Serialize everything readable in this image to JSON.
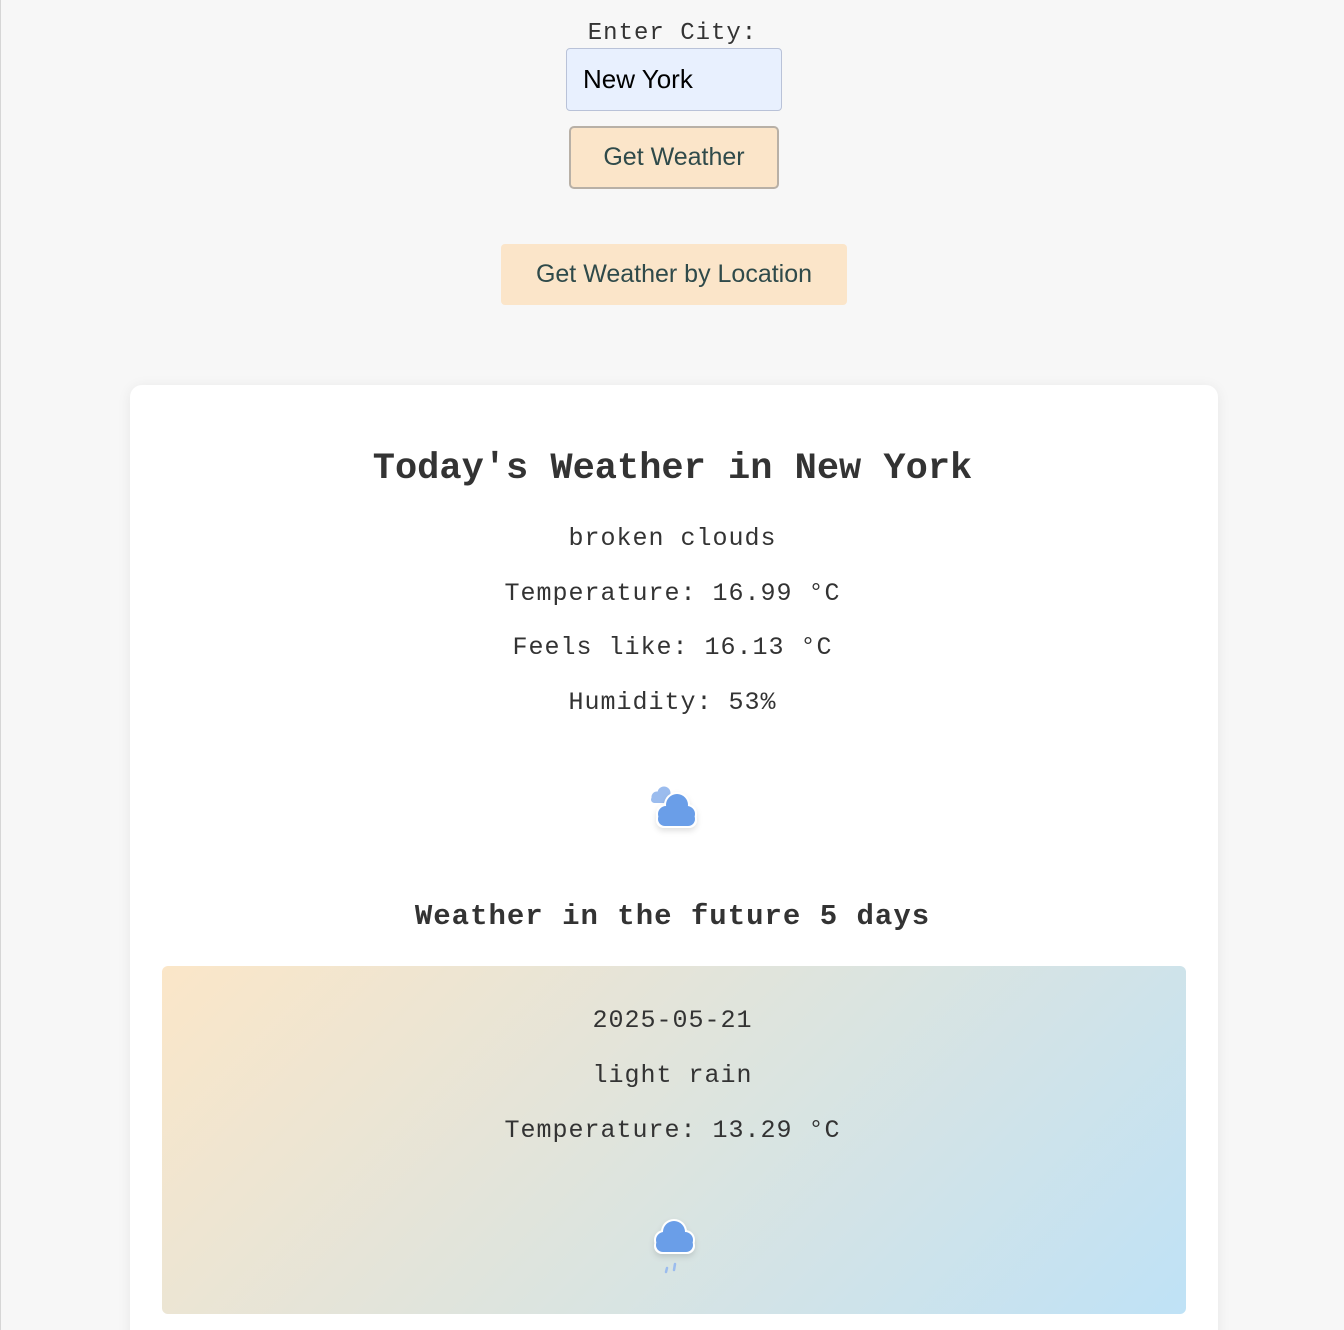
{
  "search": {
    "label": "Enter City:",
    "input_value": "New York",
    "get_weather_label": "Get Weather",
    "location_label": "Get Weather by Location"
  },
  "today": {
    "title": "Today's Weather in New York",
    "description": "broken clouds",
    "temperature": "Temperature: 16.99 °C",
    "feels_like": "Feels like: 16.13 °C",
    "humidity": "Humidity: 53%",
    "icon": "broken-clouds-icon"
  },
  "forecast": {
    "title": "Weather in the future 5 days",
    "days": [
      {
        "date": "2025-05-21",
        "description": "light rain",
        "temperature": "Temperature: 13.29 °C",
        "icon": "light-rain-icon"
      }
    ]
  },
  "colors": {
    "button_bg": "#fbe5c9",
    "button_text": "#2f4a4a",
    "input_bg": "#e8f0fe",
    "icon_blue": "#6a9ee8"
  }
}
